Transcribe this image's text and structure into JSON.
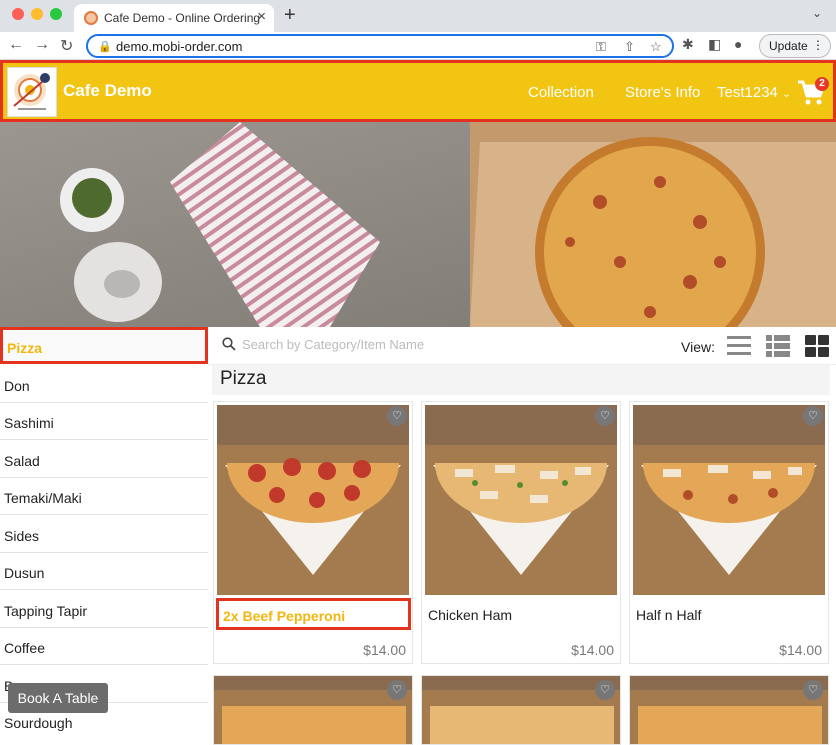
{
  "browser": {
    "tab_title": "Cafe Demo - Online Ordering",
    "url": "demo.mobi-order.com",
    "update_label": "Update"
  },
  "header": {
    "brand": "Cafe Demo",
    "nav": [
      "Collection",
      "Store's Info",
      "Test1234"
    ],
    "cart_count": "2",
    "colors": {
      "header_bg": "#f2c512",
      "highlight": "#e3321e",
      "accent": "#f2b70f"
    }
  },
  "categories": [
    "Pizza",
    "Don",
    "Sashimi",
    "Salad",
    "Temaki/Maki",
    "Sides",
    "Dusun",
    "Tapping Tapir",
    "Coffee",
    "Beverages",
    "Sourdough"
  ],
  "active_category": "Pizza",
  "search": {
    "placeholder": "Search by Category/Item Name"
  },
  "view_label": "View:",
  "section_title": "Pizza",
  "products": [
    {
      "name": "2x Beef Pepperoni",
      "price": "$14.00"
    },
    {
      "name": "Chicken Ham",
      "price": "$14.00"
    },
    {
      "name": "Half n Half",
      "price": "$14.00"
    }
  ],
  "book_table_label": "Book A Table"
}
